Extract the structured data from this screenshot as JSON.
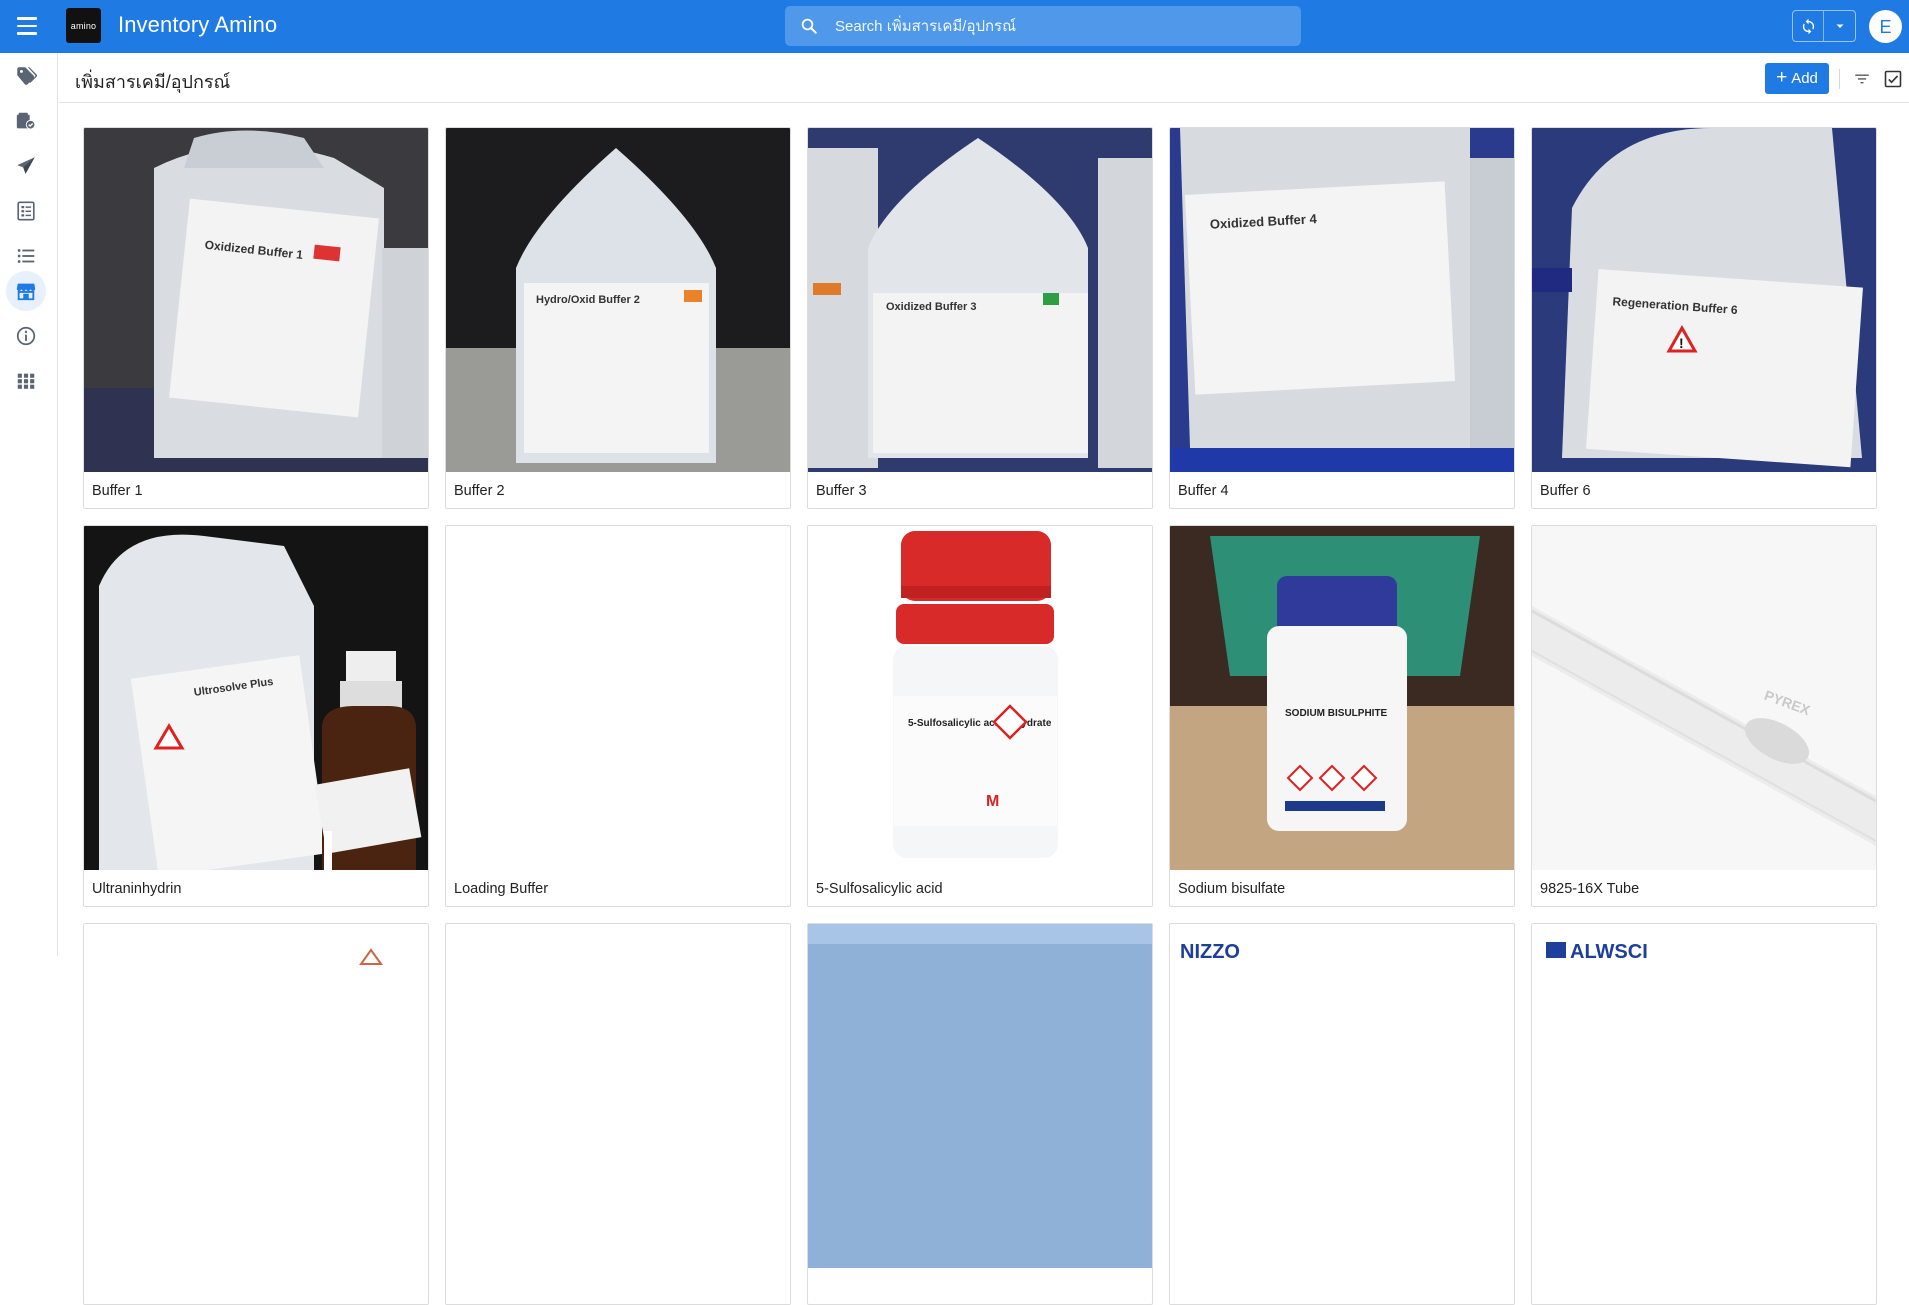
{
  "app": {
    "logo_text": "amino",
    "title": "Inventory Amino",
    "avatar_initial": "E"
  },
  "search": {
    "placeholder": "Search เพิ่มสารเคมี/อุปกรณ์"
  },
  "header": {
    "page_title": "เพิ่มสารเคมี/อุปกรณ์",
    "add_label": "Add"
  },
  "rail": [
    {
      "icon": "tags-icon"
    },
    {
      "icon": "checklist-box-icon"
    },
    {
      "icon": "paper-plane-icon"
    },
    {
      "icon": "document-list-icon"
    },
    {
      "icon": "list-icon"
    },
    {
      "icon": "store-icon",
      "active": true
    },
    {
      "icon": "info-icon"
    },
    {
      "icon": "apps-grid-icon"
    }
  ],
  "items": [
    {
      "name": "Buffer 1",
      "label_text": "Oxidized Buffer 1"
    },
    {
      "name": "Buffer 2",
      "label_text": "Hydro/Oxid Buffer 2"
    },
    {
      "name": "Buffer 3",
      "label_text": "Oxidized Buffer 3"
    },
    {
      "name": "Buffer 4",
      "label_text": "Oxidized Buffer 4"
    },
    {
      "name": "Buffer 6",
      "label_text": "Regeneration Buffer 6"
    },
    {
      "name": "Ultraninhydrin",
      "label_text": "Ultrosolve Plus"
    },
    {
      "name": "Loading Buffer",
      "label_text": ""
    },
    {
      "name": "5-Sulfosalicylic acid",
      "label_text": "5-Sulfosalicylic acid dihydrate"
    },
    {
      "name": "Sodium bisulfate",
      "label_text": "SODIUM BISULPHITE"
    },
    {
      "name": "9825-16X Tube",
      "label_text": "PYREX"
    },
    {
      "name": "",
      "label_text": ""
    },
    {
      "name": "",
      "label_text": ""
    },
    {
      "name": "",
      "label_text": ""
    },
    {
      "name": "",
      "label_text": "NIZZO"
    },
    {
      "name": "",
      "label_text": "ALWSCI"
    }
  ]
}
